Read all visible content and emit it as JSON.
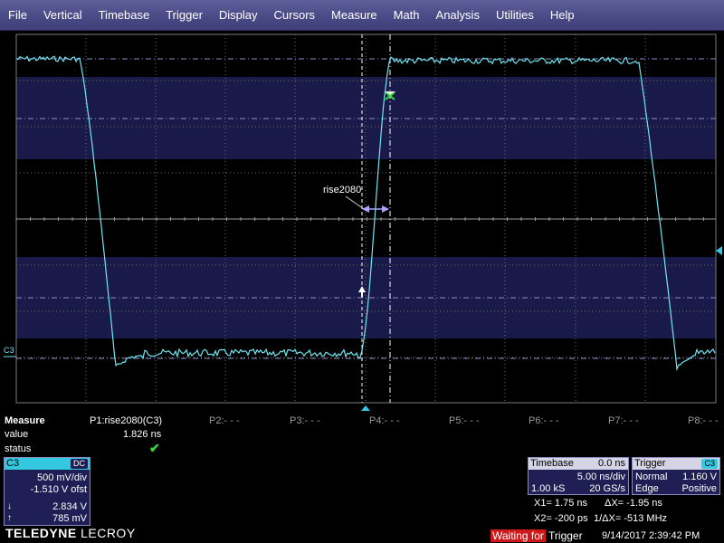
{
  "menu": [
    "File",
    "Vertical",
    "Timebase",
    "Trigger",
    "Display",
    "Cursors",
    "Measure",
    "Math",
    "Analysis",
    "Utilities",
    "Help"
  ],
  "colors": {
    "trace": "#6fe6f2",
    "grid": "#8a8a8a",
    "band": "#1a1a4a",
    "accent": "#33c8e0"
  },
  "display": {
    "channel_marker": "C3",
    "annotation_label": "rise2080"
  },
  "measure": {
    "title": "Measure",
    "row_value": "value",
    "row_status": "status",
    "p1_label": "P1:rise2080(C3)",
    "p1_value": "1.826 ns",
    "p1_status_icon": "check-icon",
    "p2": "P2:- - -",
    "p3": "P3:- - -",
    "p4": "P4:- - -",
    "p5": "P5:- - -",
    "p6": "P6:- - -",
    "p7": "P7:- - -",
    "p8": "P8:- - -"
  },
  "channel": {
    "name": "C3",
    "coupling": "DC",
    "vdiv": "500 mV/div",
    "offset": "-1.510 V ofst",
    "cursor1": "2.834 V",
    "cursor2": "785 mV"
  },
  "timebase": {
    "title": "Timebase",
    "delay": "0.0 ns",
    "tdiv": "5.00 ns/div",
    "samples": "1.00 kS",
    "rate": "20 GS/s"
  },
  "trigger": {
    "title": "Trigger",
    "source": "C3",
    "mode": "Normal",
    "level": "1.160 V",
    "type": "Edge",
    "slope": "Positive"
  },
  "cursors": {
    "x1": "X1= 1.75 ns",
    "dx": "ΔX= -1.95 ns",
    "x2": "X2= -200 ps",
    "inv_dx": "1/ΔX= -513 MHz"
  },
  "brand": {
    "name": "TELEDYNE",
    "sub": "LECROY"
  },
  "status": {
    "waiting_prefix": "Waiting for",
    "waiting_word": "Trigger",
    "datetime": "9/14/2017 2:39:42 PM"
  }
}
